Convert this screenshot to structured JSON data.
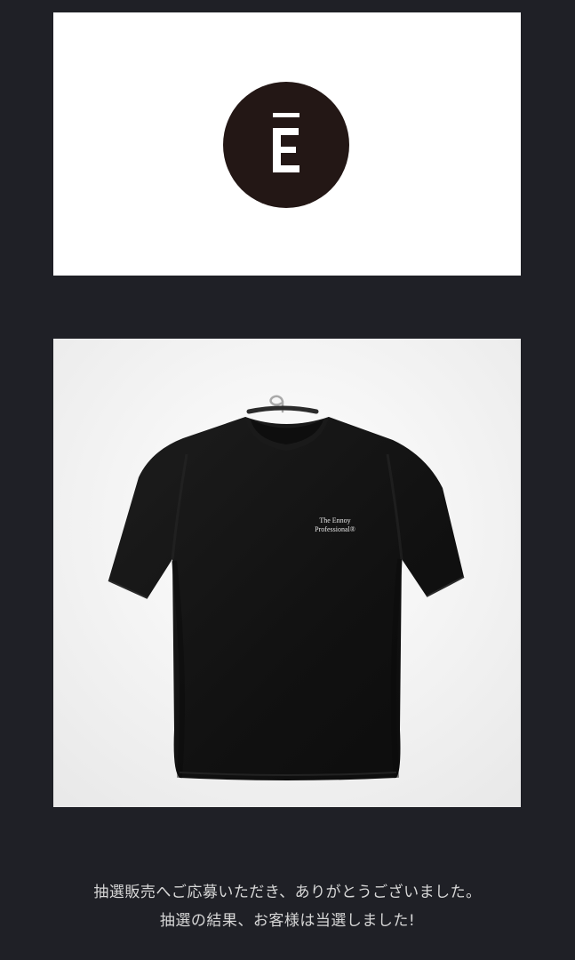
{
  "logo": {
    "letter": "E",
    "icon": "ennoy-e-logo-icon",
    "circle_color": "#231715",
    "letter_color": "#ffffff"
  },
  "product": {
    "image": "black-tshirt-on-hanger",
    "print_line1": "The Ennoy",
    "print_line2": "Professional®"
  },
  "message": {
    "line1": "抽選販売へご応募いただき、ありがとうございました。",
    "line2": "抽選の結果、お客様は当選しました!"
  },
  "colors": {
    "background": "#1f2026",
    "card": "#ffffff",
    "text": "#d7d7d7"
  }
}
